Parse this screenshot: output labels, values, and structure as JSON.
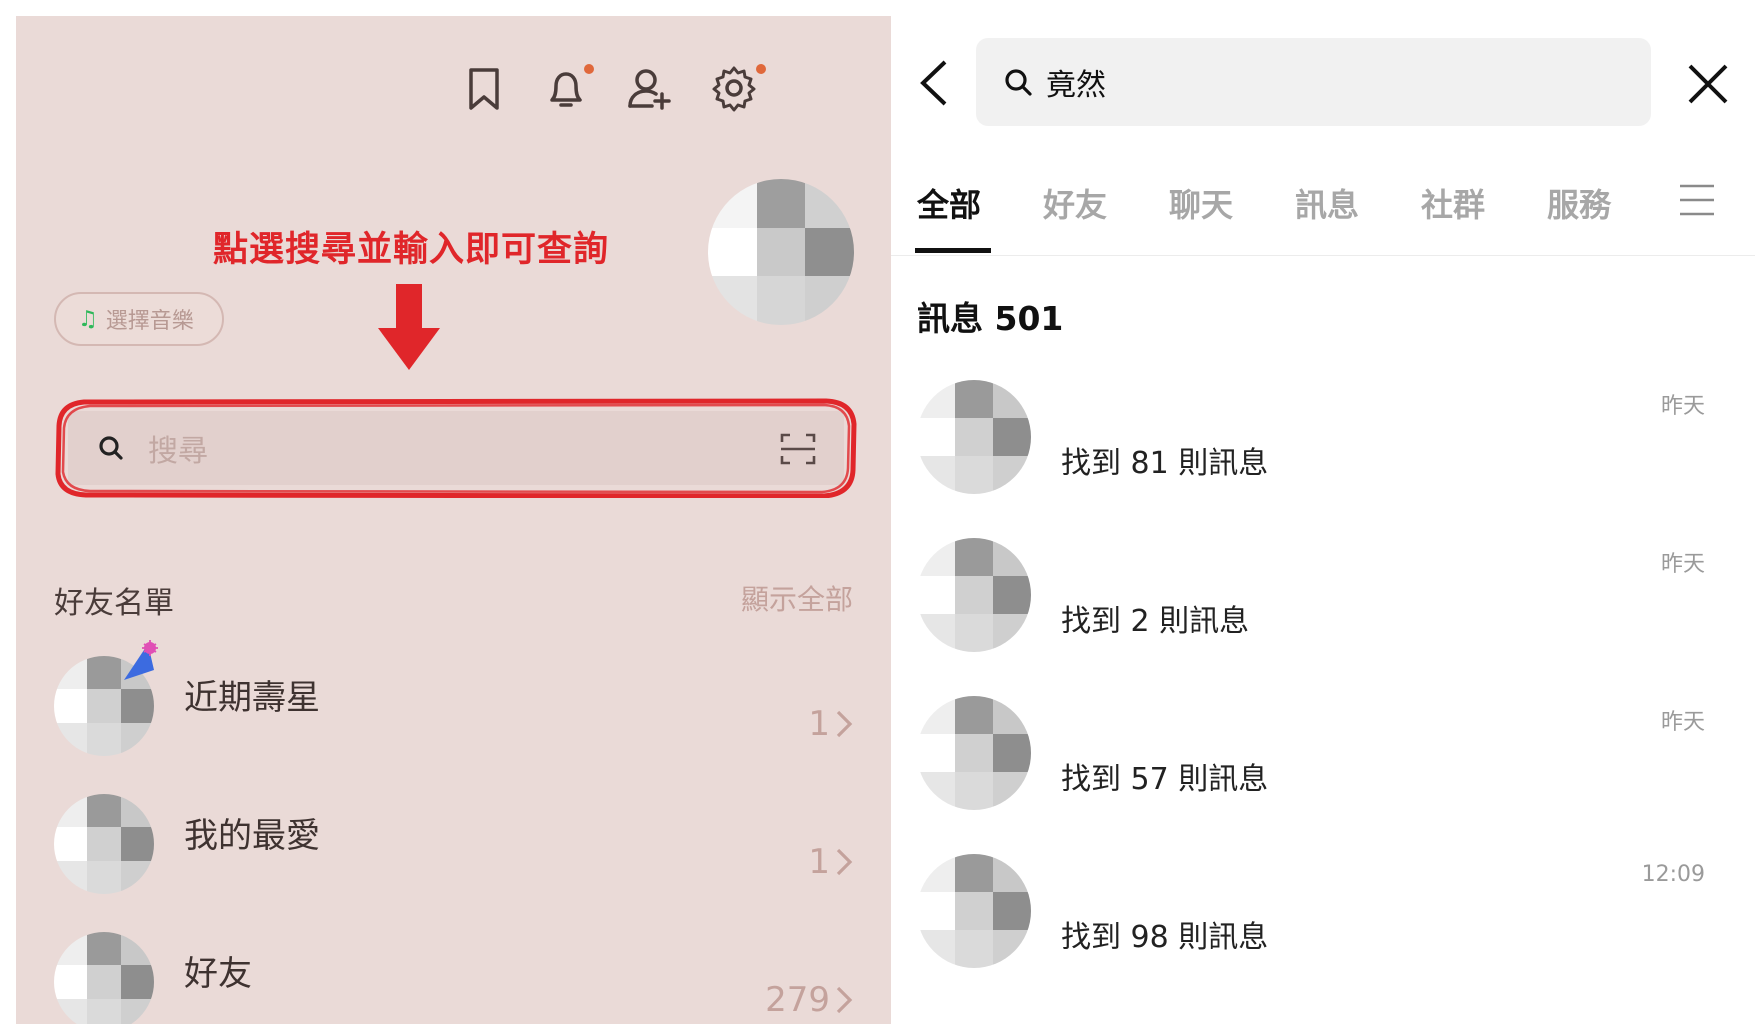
{
  "left": {
    "icons": [
      "bookmark-icon",
      "bell-icon",
      "add-friend-icon",
      "gear-icon"
    ],
    "hint": "點選搜尋並輸入即可查詢",
    "music_button": "選擇音樂",
    "search_placeholder": "搜尋",
    "friend_list_title": "好友名單",
    "show_all": "顯示全部",
    "items": [
      {
        "label": "近期壽星",
        "count": "1"
      },
      {
        "label": "我的最愛",
        "count": "1"
      },
      {
        "label": "好友",
        "count": "279"
      }
    ],
    "trailing_text": "，…"
  },
  "right": {
    "search_value": "竟然",
    "tabs": [
      "全部",
      "好友",
      "聊天",
      "訊息",
      "社群",
      "服務"
    ],
    "active_tab": "全部",
    "section_title": "訊息 501",
    "results": [
      {
        "text": "找到 81 則訊息",
        "time": "昨天"
      },
      {
        "text": "找到 2 則訊息",
        "time": "昨天"
      },
      {
        "text": "找到 57 則訊息",
        "time": "昨天"
      },
      {
        "text": "找到 98 則訊息",
        "time": "12:09"
      }
    ]
  },
  "colors": {
    "left_bg": "#eadad7",
    "hint_red": "#e0262a",
    "notification_dot": "#e0683b"
  }
}
